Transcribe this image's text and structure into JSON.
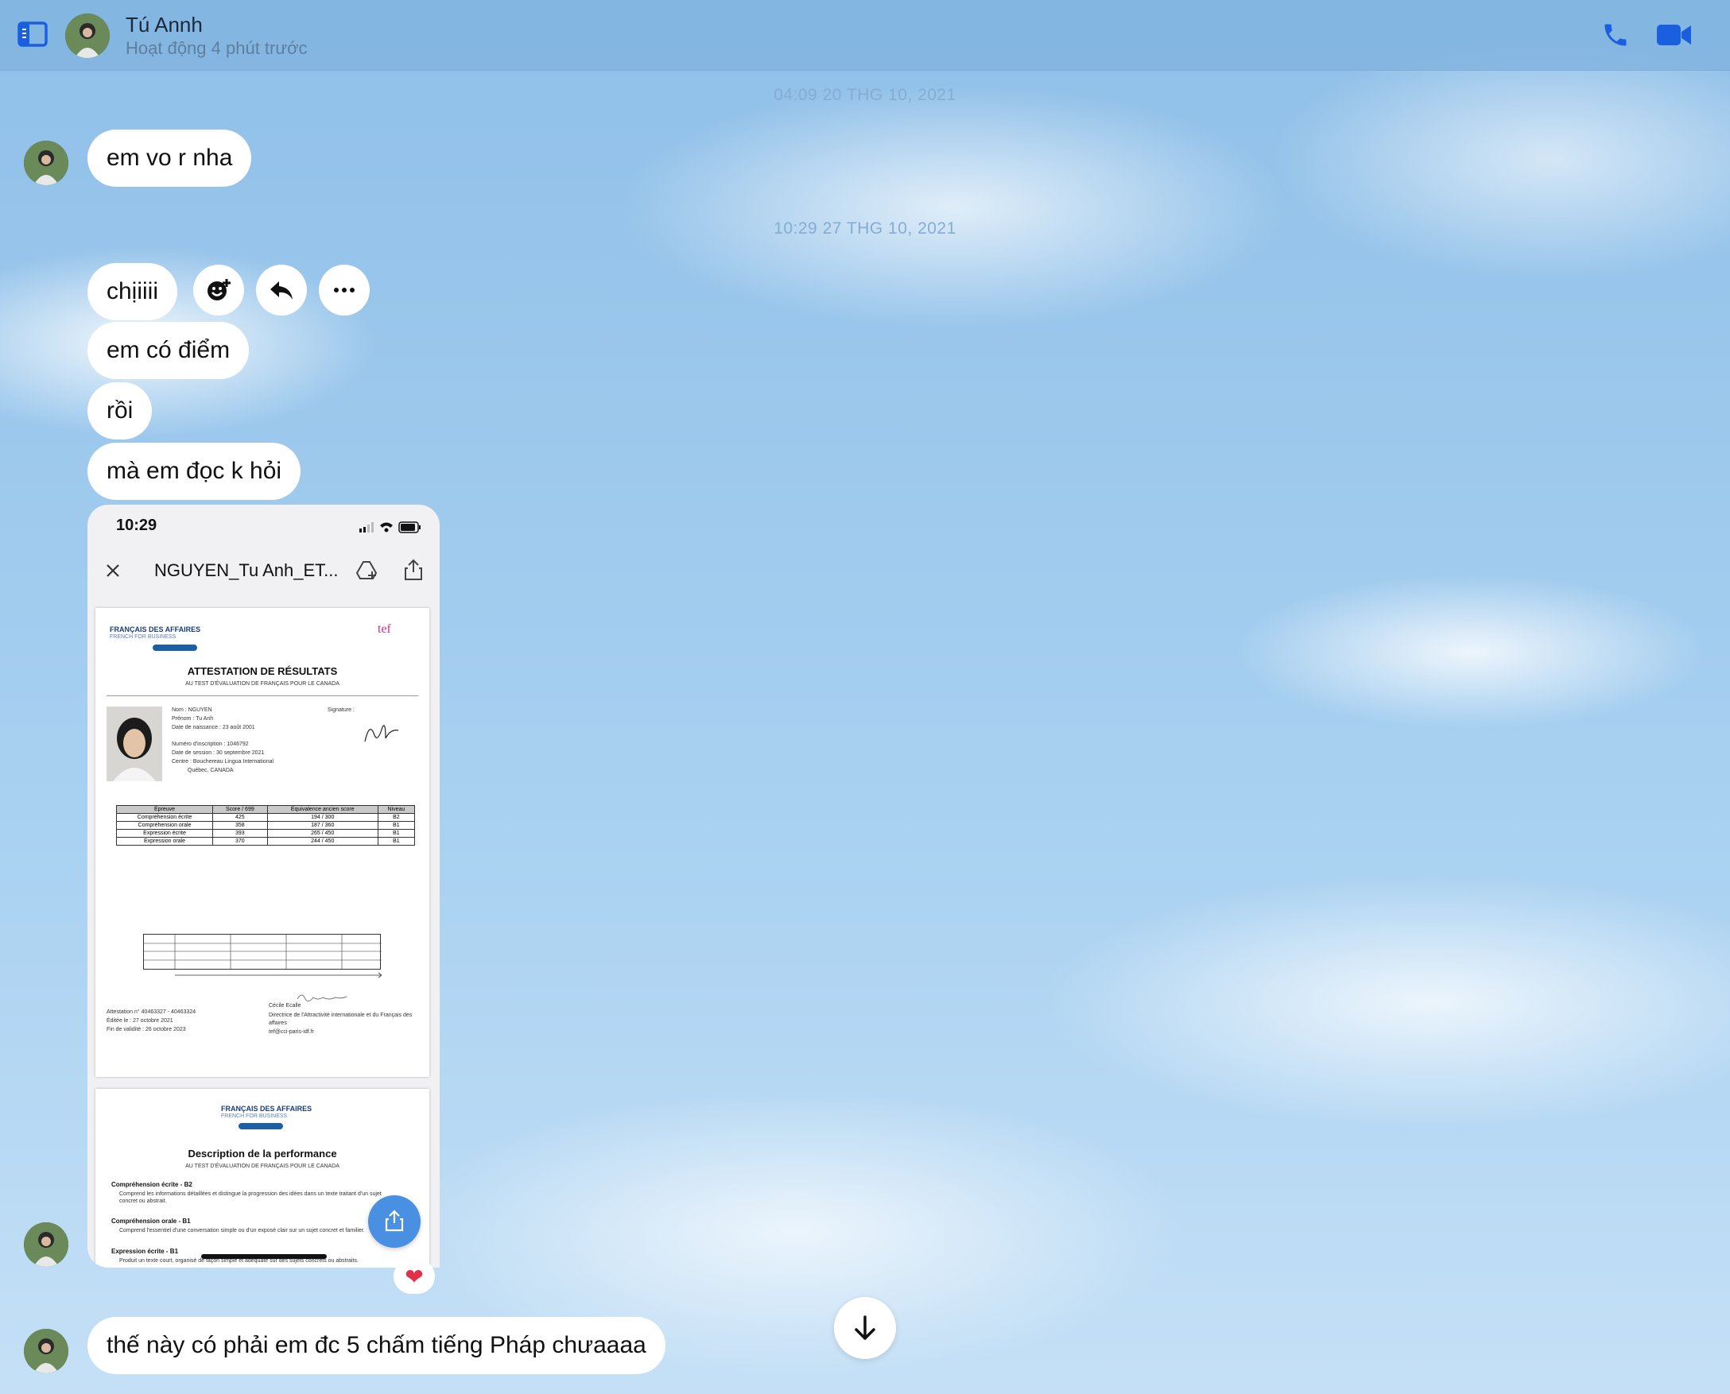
{
  "header": {
    "name": "Tú Annh",
    "status": "Hoạt động 4 phút trước"
  },
  "dates": {
    "first": "04:09 20 THG 10, 2021",
    "second": "10:29 27 THG 10, 2021"
  },
  "messages": [
    {
      "text": "em vo r nha"
    },
    {
      "text": "chịiiii"
    },
    {
      "text": "em có điểm"
    },
    {
      "text": "rồi"
    },
    {
      "text": "mà em đọc k hỏi"
    },
    {
      "text": "thế này có phải em đc 5 chấm tiếng Pháp chưaaaa"
    }
  ],
  "attachment": {
    "phone_time": "10:29",
    "doc_title": "NGUYEN_Tu Anh_ET...",
    "page1": {
      "brand": "FRANÇAIS DES AFFAIRES",
      "brand_sub": "FRENCH FOR BUSINESS",
      "tef": "tef",
      "heading": "ATTESTATION DE RÉSULTATS",
      "subheading": "AU TEST D'ÉVALUATION DE FRANÇAIS POUR LE CANADA",
      "details": [
        "Nom : NGUYEN",
        "Prénom : Tu Anh",
        "Date de naissance : 23 août 2001",
        "Numéro d'inscription : 1046792",
        "Date de session : 30 septembre 2021",
        "Centre : Bouchereau Lingua International",
        "Québec, CANADA"
      ],
      "signature_label": "Signature :",
      "table_headers": [
        "Épreuve",
        "Score / 699",
        "Équivalence ancien score",
        "Niveau"
      ],
      "table_rows": [
        [
          "Compréhension écrite",
          "425",
          "194 / 300",
          "B2"
        ],
        [
          "Compréhension orale",
          "358",
          "187 / 360",
          "B1"
        ],
        [
          "Expression écrite",
          "393",
          "265 / 450",
          "B1"
        ],
        [
          "Expression orale",
          "370",
          "244 / 450",
          "B1"
        ]
      ],
      "footer_left": [
        "Attestation n° 40463327 - 40463324",
        "Éditée le : 27 octobre 2021",
        "Fin de validité : 26 octobre 2023"
      ],
      "footer_right": [
        "Cécile Ecalle",
        "Directrice de l'Attractivité internationale et du Français des affaires",
        "tef@cci-paris-idf.fr"
      ]
    },
    "page2": {
      "brand": "FRANÇAIS DES AFFAIRES",
      "brand_sub": "FRENCH FOR BUSINESS",
      "heading": "Description de la performance",
      "subheading": "AU TEST D'ÉVALUATION DE FRANÇAIS POUR LE CANADA",
      "sections": [
        {
          "title": "Compréhension écrite - B2",
          "text": "Comprend les informations détaillées et distingue la progression des idées dans un texte traitant d'un sujet concret ou abstrait."
        },
        {
          "title": "Compréhension orale - B1",
          "text": "Comprend l'essentiel d'une conversation simple ou d'un exposé clair sur un sujet concret et familier."
        },
        {
          "title": "Expression écrite - B1",
          "text": "Produit un texte court, organisé de façon simple et adéquate sur des sujets concrets ou abstraits."
        }
      ]
    }
  },
  "reaction": "❤",
  "colors": {
    "accent": "#1a5fe0",
    "bubble": "#ffffff",
    "fab": "#4a90e2"
  }
}
